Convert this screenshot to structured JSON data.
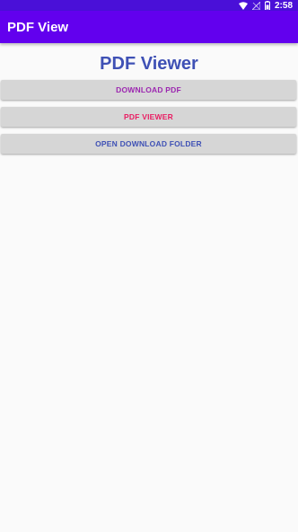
{
  "status_bar": {
    "time": "2:58",
    "icons": [
      "wifi-icon",
      "signal-icon",
      "battery-icon"
    ]
  },
  "app_bar": {
    "title": "PDF View"
  },
  "main": {
    "heading": "PDF Viewer",
    "buttons": [
      {
        "label": "DOWNLOAD PDF",
        "color": "#9c27b0"
      },
      {
        "label": "PDF VIEWER",
        "color": "#e91e63"
      },
      {
        "label": "OPEN DOWNLOAD FOLDER",
        "color": "#3f51b5"
      }
    ]
  },
  "colors": {
    "status_bar": "#4a10d8",
    "app_bar": "#6200ee",
    "heading": "#3f51b5",
    "background": "#fafafa",
    "button_background": "#d6d6d6"
  }
}
